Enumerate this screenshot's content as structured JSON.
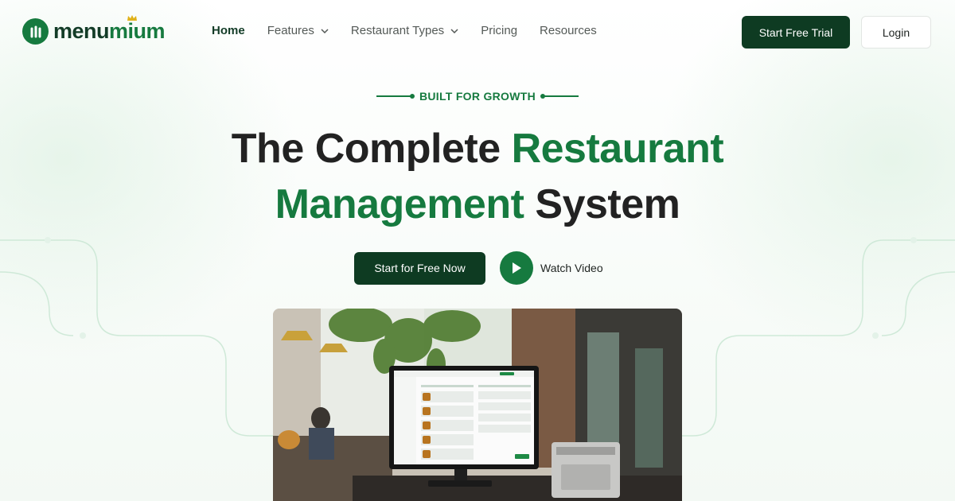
{
  "brand": {
    "name_part1": "menu",
    "name_part2": "mium",
    "logo_icon": "menumium-logo-icon",
    "primary_color": "#167a3f",
    "dark_color": "#0e3b22"
  },
  "nav": {
    "items": [
      {
        "label": "Home",
        "active": true,
        "dropdown": false
      },
      {
        "label": "Features",
        "active": false,
        "dropdown": true
      },
      {
        "label": "Restaurant Types",
        "active": false,
        "dropdown": true
      },
      {
        "label": "Pricing",
        "active": false,
        "dropdown": false
      },
      {
        "label": "Resources",
        "active": false,
        "dropdown": false
      }
    ],
    "trial_label": "Start Free Trial",
    "login_label": "Login"
  },
  "hero": {
    "eyebrow": "BUILT FOR GROWTH",
    "title_part1": "The Complete ",
    "title_part2": "Restaurant",
    "title_part3": "Management",
    "title_part4": " System",
    "cta_label": "Start for Free Now",
    "video_label": "Watch Video",
    "play_icon": "play-icon",
    "image_icon": "restaurant-pos-photo"
  }
}
